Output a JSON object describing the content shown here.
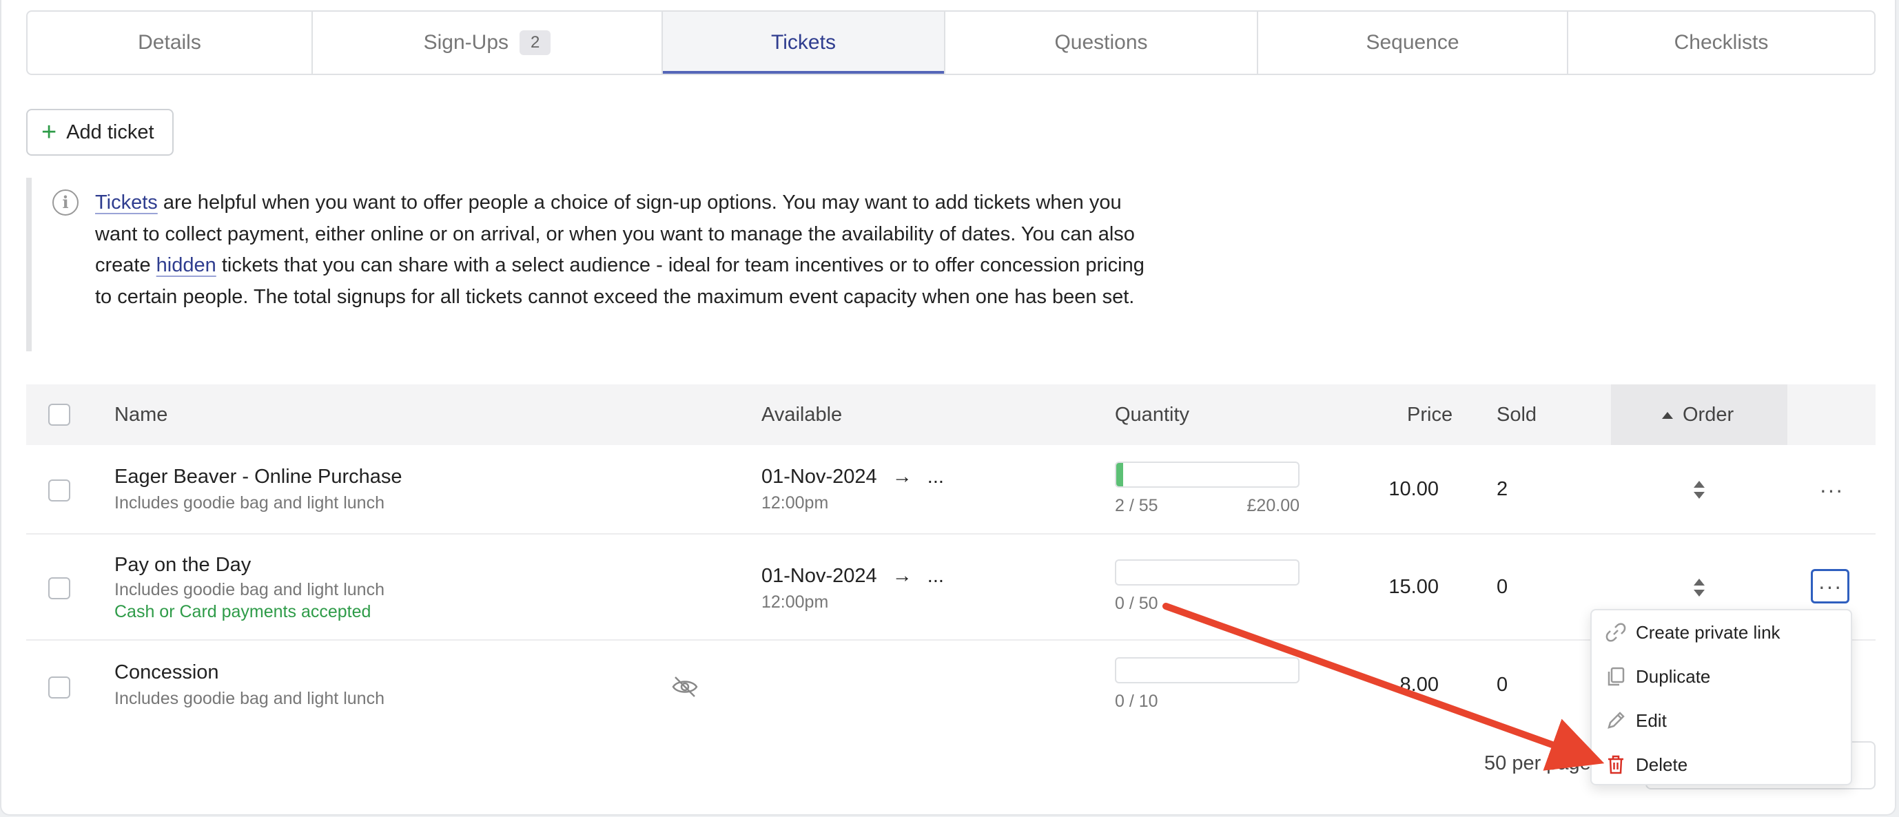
{
  "tabs": [
    {
      "label": "Details",
      "badge": ""
    },
    {
      "label": "Sign-Ups",
      "badge": "2"
    },
    {
      "label": "Tickets",
      "badge": ""
    },
    {
      "label": "Questions",
      "badge": ""
    },
    {
      "label": "Sequence",
      "badge": ""
    },
    {
      "label": "Checklists",
      "badge": ""
    }
  ],
  "toolbar": {
    "add_ticket_label": "Add ticket"
  },
  "info": {
    "link_tickets": "Tickets",
    "text_1": " are helpful when you want to offer people a choice of sign-up options. You may want to add tickets when you want to collect payment, either online or on arrival, or when you want to manage the availability of dates. You can also create ",
    "link_hidden": "hidden",
    "text_2": " tickets that you can share with a select audience - ideal for team incentives or to offer concession pricing to certain people. The total signups for all tickets cannot exceed the maximum event capacity when one has been set."
  },
  "table": {
    "headers": {
      "name": "Name",
      "available": "Available",
      "quantity": "Quantity",
      "price": "Price",
      "sold": "Sold",
      "order": "Order"
    },
    "rows": [
      {
        "name": "Eager Beaver - Online Purchase",
        "desc": "Includes goodie bag and light lunch",
        "note": "",
        "date": "01-Nov-2024",
        "arrow": "→",
        "end": "...",
        "time": "12:00pm",
        "qty": "2 / 55",
        "qty_fraction": 0.036,
        "revenue": "£20.00",
        "price": "10.00",
        "sold": "2",
        "hidden": false
      },
      {
        "name": "Pay on the Day",
        "desc": "Includes goodie bag and light lunch",
        "note": "Cash or Card payments accepted",
        "date": "01-Nov-2024",
        "arrow": "→",
        "end": "...",
        "time": "12:00pm",
        "qty": "0 / 50",
        "qty_fraction": 0,
        "revenue": "",
        "price": "15.00",
        "sold": "0",
        "hidden": false
      },
      {
        "name": "Concession",
        "desc": "Includes goodie bag and light lunch",
        "note": "",
        "date": "",
        "arrow": "",
        "end": "",
        "time": "",
        "qty": "0 / 10",
        "qty_fraction": 0,
        "revenue": "",
        "price": "8.00",
        "sold": "0",
        "hidden": true
      }
    ]
  },
  "menu": {
    "items": [
      {
        "label": "Create private link",
        "icon": "link-icon"
      },
      {
        "label": "Duplicate",
        "icon": "duplicate-icon"
      },
      {
        "label": "Edit",
        "icon": "pencil-icon"
      },
      {
        "label": "Delete",
        "icon": "trash-icon"
      }
    ]
  },
  "pagination": {
    "per_page": "50 per page"
  },
  "colors": {
    "accent": "#2f3d8f",
    "success": "#2e9b48",
    "danger": "#d93025",
    "annotation": "#e8442d"
  }
}
